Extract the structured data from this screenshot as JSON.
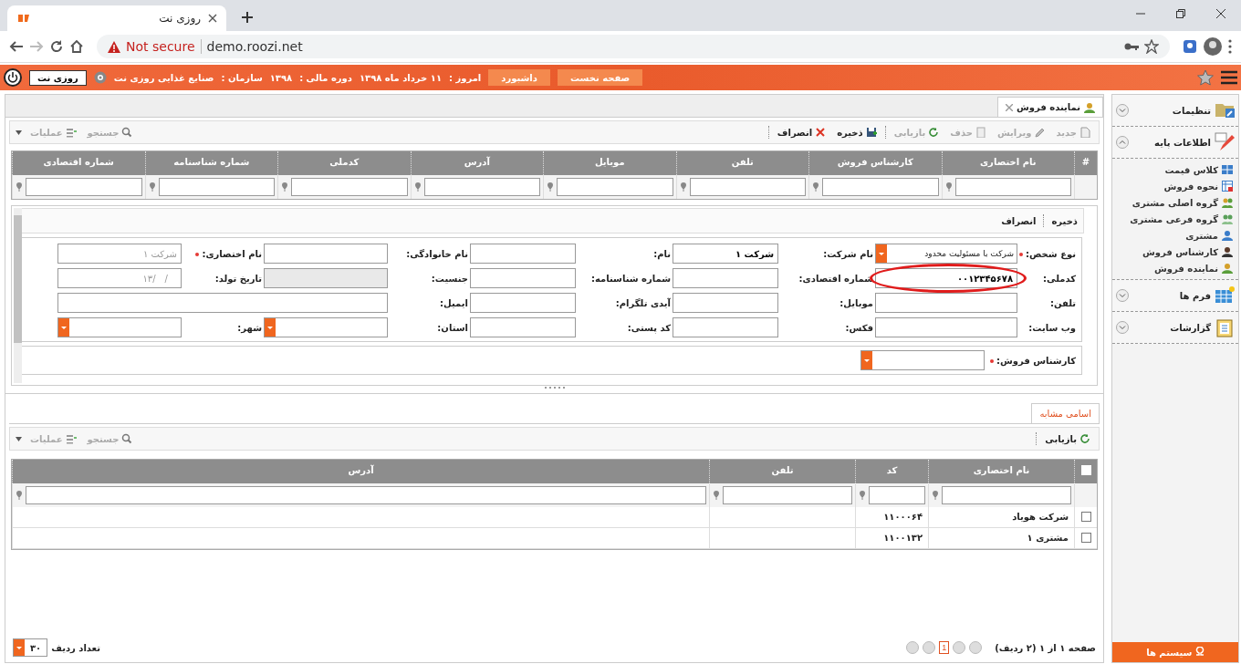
{
  "browser": {
    "tab_title": "روزی نت",
    "security": "Not secure",
    "url": "demo.roozi.net"
  },
  "header": {
    "buttons": [
      {
        "label": "صفحه نخست"
      },
      {
        "label": "داشبورد"
      }
    ],
    "today_label": "امروز :",
    "today": "۱۱ خرداد ماه ۱۳۹۸",
    "year_label": "دوره مالی :",
    "year": "۱۳۹۸",
    "org_label": "سازمان :",
    "org": "صنایع غذایی روزی نت",
    "app_name": "روزی نت"
  },
  "page_tab": {
    "label": "نماینده فروش",
    "selected": true
  },
  "toolbar": {
    "items": [
      {
        "label": "جدید",
        "kind": "new",
        "disabled": true
      },
      {
        "label": "ویرایش",
        "kind": "edit",
        "disabled": true
      },
      {
        "label": "حذف",
        "kind": "delete",
        "disabled": true
      },
      {
        "label": "بازیابی",
        "kind": "refresh",
        "disabled": true
      },
      {
        "label": "ذخیره",
        "kind": "save",
        "disabled": false
      },
      {
        "label": "انصراف",
        "kind": "cancel",
        "disabled": false
      }
    ],
    "left": [
      {
        "label": "جستجو",
        "kind": "search"
      },
      {
        "label": "عملیات",
        "kind": "ops"
      }
    ]
  },
  "grid": {
    "index_header": "#",
    "columns": [
      "نام اختصاری",
      "کارشناس فروش",
      "تلفن",
      "موبایل",
      "آدرس",
      "کدملی",
      "شماره شناسنامه",
      "شماره اقتصادی"
    ]
  },
  "form": {
    "actions": [
      "ذخیره",
      "انصراف"
    ],
    "rows": [
      [
        {
          "label": "نوع شخص:",
          "required": true,
          "kind": "select",
          "value": "شرکت با مسئولیت محدود"
        },
        {
          "label": "نام شرکت:",
          "kind": "text",
          "value": "شرکت ۱"
        },
        {
          "label": "نام:",
          "kind": "text"
        },
        {
          "label": "نام خانوادگی:",
          "kind": "text"
        },
        {
          "label": "نام اختصاری:",
          "required": true,
          "kind": "text",
          "placeholder": "شرکت ۱"
        }
      ],
      [
        {
          "label": "کدملی:",
          "kind": "text",
          "value": "۰۰۱۲۳۴۵۶۷۸",
          "circled": true
        },
        {
          "label": "شماره اقتصادی:",
          "kind": "text"
        },
        {
          "label": "شماره شناسنامه:",
          "kind": "text"
        },
        {
          "label": "جنسیت:",
          "kind": "text",
          "disabled": true
        },
        {
          "label": "تاریخ تولد:",
          "kind": "text",
          "placeholder": "__/__/۱۳"
        }
      ],
      [
        {
          "label": "تلفن:",
          "kind": "text"
        },
        {
          "label": "موبایل:",
          "kind": "text"
        },
        {
          "label": "آیدی تلگرام:",
          "kind": "text"
        },
        {
          "label": "ایمیل:",
          "kind": "text"
        }
      ],
      [
        {
          "label": "وب سایت:",
          "kind": "text"
        },
        {
          "label": "فکس:",
          "kind": "text"
        },
        {
          "label": "کد پستی:",
          "kind": "text"
        },
        {
          "label": "استان:",
          "kind": "select"
        },
        {
          "label": "شهر:",
          "kind": "select"
        }
      ]
    ],
    "sales_expert": {
      "label": "کارشناس فروش:",
      "required": true
    }
  },
  "similar": {
    "tab": {
      "label": "اسامی مشابه",
      "selected": true
    },
    "toolbar": [
      {
        "label": "بازیابی",
        "kind": "refresh"
      }
    ],
    "left": [
      {
        "label": "جستجو",
        "kind": "search"
      },
      {
        "label": "عملیات",
        "kind": "ops"
      }
    ],
    "select_all": {
      "checked": false
    },
    "columns": [
      "نام اختصاری",
      "کد",
      "تلفن",
      "آدرس"
    ],
    "rows": [
      {
        "checked": false,
        "name": "شرکت هویاد",
        "code": "۱۱۰۰۰۶۴"
      },
      {
        "checked": false,
        "name": "مشتری ۱",
        "code": "۱۱۰۰۱۳۲"
      }
    ],
    "pager": {
      "info": "صفحه ۱ از ۱ (۲ ردیف)",
      "page": "1",
      "rows_label": "تعداد ردیف",
      "rows_per_page": "۳۰"
    }
  },
  "sidebar": {
    "sections": [
      {
        "label": "تنظیمات",
        "kind": "settings",
        "expanded": false
      },
      {
        "label": "اطلاعات پایه",
        "kind": "base",
        "expanded": true,
        "children": [
          {
            "label": "کلاس قیمت",
            "kind": "grid"
          },
          {
            "label": "نحوه فروش",
            "kind": "table"
          },
          {
            "label": "گروه اصلی مشتری",
            "kind": "group"
          },
          {
            "label": "گروه فرعی مشتری",
            "kind": "subgroup"
          },
          {
            "label": "مشتری",
            "kind": "person"
          },
          {
            "label": "کارشناس فروش",
            "kind": "expert"
          },
          {
            "label": "نماینده فروش",
            "kind": "agent"
          }
        ]
      },
      {
        "label": "فرم ها",
        "kind": "forms",
        "expanded": false
      },
      {
        "label": "گزارشات",
        "kind": "reports",
        "expanded": false
      }
    ],
    "footer": "سیستم ها"
  }
}
